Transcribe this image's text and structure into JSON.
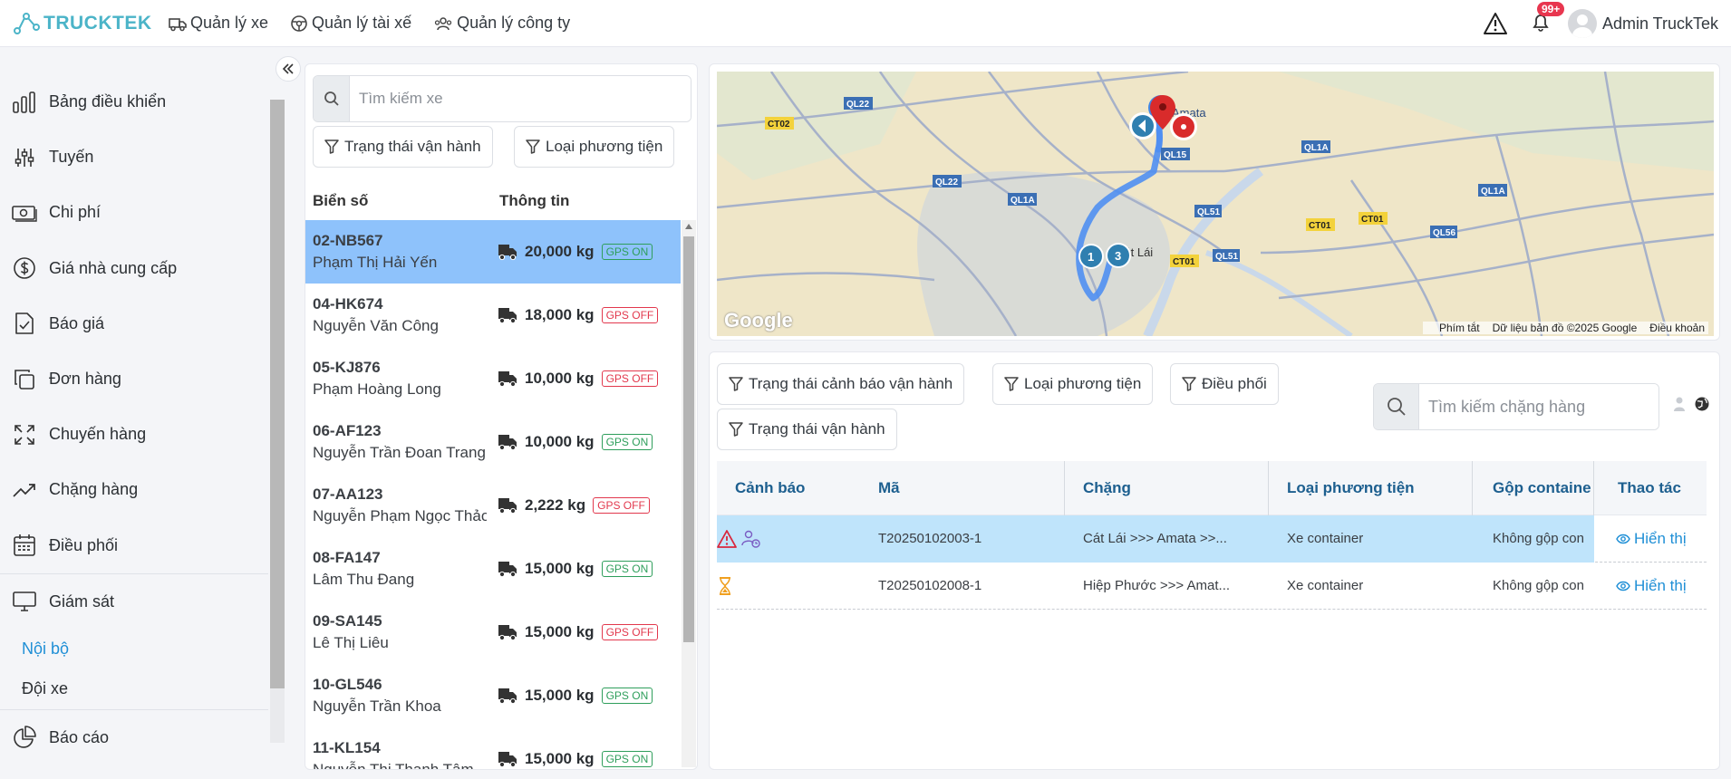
{
  "app": {
    "brand": "TRUCKTEK",
    "nav": [
      {
        "label": "Quản lý xe",
        "icon": "truck-icon"
      },
      {
        "label": "Quản lý tài xế",
        "icon": "steering-wheel-icon"
      },
      {
        "label": "Quản lý công ty",
        "icon": "users-icon"
      }
    ],
    "notification_badge": "99+",
    "user_name": "Admin TruckTek"
  },
  "sidebar": {
    "items": [
      {
        "label": "Bảng điều khiển",
        "icon": "bar-chart-icon"
      },
      {
        "label": "Tuyến",
        "icon": "sliders-icon"
      },
      {
        "label": "Chi phí",
        "icon": "money-icon"
      },
      {
        "label": "Giá nhà cung cấp",
        "icon": "dollar-icon"
      },
      {
        "label": "Báo giá",
        "icon": "document-check-icon"
      },
      {
        "label": "Đơn hàng",
        "icon": "copy-icon"
      },
      {
        "label": "Chuyến hàng",
        "icon": "expand-icon"
      },
      {
        "label": "Chặng hàng",
        "icon": "trend-icon"
      },
      {
        "label": "Điều phối",
        "icon": "calendar-icon"
      },
      {
        "label": "Giám sát",
        "icon": "monitor-icon"
      }
    ],
    "sub_items": [
      {
        "label": "Nội bộ",
        "active": true
      },
      {
        "label": "Đội xe",
        "active": false
      }
    ],
    "report": {
      "label": "Báo cáo",
      "icon": "pie-chart-icon"
    }
  },
  "vehicles": {
    "search_placeholder": "Tìm kiếm xe",
    "filters": [
      "Trạng thái vận hành",
      "Loại phương tiện"
    ],
    "columns": [
      "Biển số",
      "Thông tin"
    ],
    "rows": [
      {
        "plate": "02-NB567",
        "driver": "Phạm Thị Hải Yến",
        "weight": "20,000 kg",
        "gps": "GPS ON"
      },
      {
        "plate": "04-HK674",
        "driver": "Nguyễn Văn Công",
        "weight": "18,000 kg",
        "gps": "GPS OFF"
      },
      {
        "plate": "05-KJ876",
        "driver": "Phạm Hoàng Long",
        "weight": "10,000 kg",
        "gps": "GPS OFF"
      },
      {
        "plate": "06-AF123",
        "driver": "Nguyễn Trần Đoan Trang",
        "weight": "10,000 kg",
        "gps": "GPS ON"
      },
      {
        "plate": "07-AA123",
        "driver": "Nguyễn Phạm Ngọc Thảo",
        "weight": "2,222 kg",
        "gps": "GPS OFF"
      },
      {
        "plate": "08-FA147",
        "driver": "Lâm Thu Đang",
        "weight": "15,000 kg",
        "gps": "GPS ON"
      },
      {
        "plate": "09-SA145",
        "driver": "Lê Thị Liêu",
        "weight": "15,000 kg",
        "gps": "GPS OFF"
      },
      {
        "plate": "10-GL546",
        "driver": "Nguyễn Trần Khoa",
        "weight": "15,000 kg",
        "gps": "GPS ON"
      },
      {
        "plate": "11-KL154",
        "driver": "Nguyễn Thị Thanh Tâm",
        "weight": "15,000 kg",
        "gps": "GPS ON"
      }
    ]
  },
  "map": {
    "labels": {
      "ql22a": "QL22",
      "ct02": "CT02",
      "ql22b": "QL22",
      "ql1a_a": "QL1A",
      "ql1a_b": "QL1A",
      "ql1a_c": "QL1A",
      "ql15": "QL15",
      "ql51a": "QL51",
      "ql51b": "QL51",
      "ct01a": "CT01",
      "ct01b": "CT01",
      "ct01c": "CT01",
      "ql56": "QL56"
    },
    "places": {
      "amata": "Amata",
      "catlai": "Cát Lái"
    },
    "markers": [
      "1",
      "3"
    ],
    "google": "Google",
    "footer": [
      "Phím tắt",
      "Dữ liệu bản đồ ©2025 Google",
      "Điều khoản"
    ]
  },
  "segments": {
    "filters": [
      "Trạng thái cảnh báo vận hành",
      "Loại phương tiện",
      "Điều phối",
      "Trạng thái vận hành"
    ],
    "search_placeholder": "Tìm kiếm chặng hàng",
    "columns": [
      "Cảnh báo",
      "Mã",
      "Chặng",
      "Loại phương tiện",
      "Gộp containe",
      "Thao tác"
    ],
    "rows": [
      {
        "code": "T20250102003-1",
        "route": "Cát Lái >>> Amata >>...",
        "vehicle_type": "Xe container",
        "merge": "Không gộp con",
        "action": "Hiển thị",
        "warning": [
          "warning-triangle-icon",
          "driver-clock-icon"
        ]
      },
      {
        "code": "T20250102008-1",
        "route": "Hiệp Phước >>> Amat...",
        "vehicle_type": "Xe container",
        "merge": "Không gộp con",
        "action": "Hiển thị",
        "warning": [
          "hourglass-icon"
        ]
      }
    ]
  },
  "colors": {
    "brand": "#4bb4c8",
    "selected_row": "#8ec2fb",
    "table_selected": "#bfe4fb",
    "link": "#1f8fd6",
    "gps_on": "#2e9e5b",
    "gps_off": "#e2384d"
  }
}
